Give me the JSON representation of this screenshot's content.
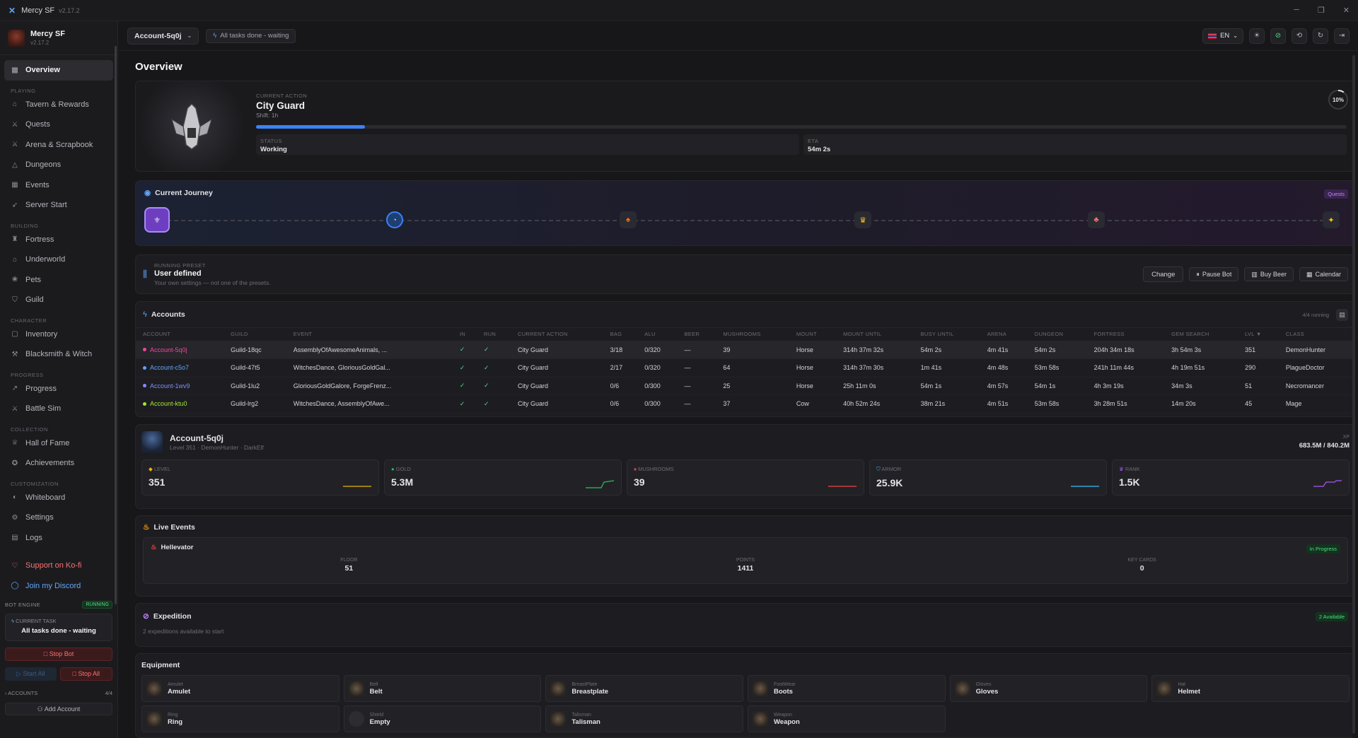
{
  "titlebar": {
    "app": "Mercy SF",
    "version": "v2.17.2"
  },
  "sidebar": {
    "name": "Mercy SF",
    "version": "v2.17.2",
    "items": [
      {
        "type": "item",
        "label": "Overview",
        "icon": "grid-icon",
        "active": true
      },
      {
        "type": "section",
        "label": "PLAYING"
      },
      {
        "type": "item",
        "label": "Tavern & Rewards",
        "icon": "tavern-icon"
      },
      {
        "type": "item",
        "label": "Quests",
        "icon": "swords-icon"
      },
      {
        "type": "item",
        "label": "Arena & Scrapbook",
        "icon": "swords-icon"
      },
      {
        "type": "item",
        "label": "Dungeons",
        "icon": "mountain-icon"
      },
      {
        "type": "item",
        "label": "Events",
        "icon": "calendar-icon"
      },
      {
        "type": "item",
        "label": "Server Start",
        "icon": "rocket-icon"
      },
      {
        "type": "section",
        "label": "BUILDING"
      },
      {
        "type": "item",
        "label": "Fortress",
        "icon": "castle-icon"
      },
      {
        "type": "item",
        "label": "Underworld",
        "icon": "home-icon"
      },
      {
        "type": "item",
        "label": "Pets",
        "icon": "paw-icon"
      },
      {
        "type": "item",
        "label": "Guild",
        "icon": "shield-icon"
      },
      {
        "type": "section",
        "label": "CHARACTER"
      },
      {
        "type": "item",
        "label": "Inventory",
        "icon": "backpack-icon"
      },
      {
        "type": "item",
        "label": "Blacksmith & Witch",
        "icon": "hammer-icon"
      },
      {
        "type": "section",
        "label": "PROGRESS"
      },
      {
        "type": "item",
        "label": "Progress",
        "icon": "trend-icon"
      },
      {
        "type": "item",
        "label": "Battle Sim",
        "icon": "swords-icon"
      },
      {
        "type": "section",
        "label": "COLLECTION"
      },
      {
        "type": "item",
        "label": "Hall of Fame",
        "icon": "trophy-icon"
      },
      {
        "type": "item",
        "label": "Achievements",
        "icon": "medal-icon"
      },
      {
        "type": "section",
        "label": "CUSTOMIZATION"
      },
      {
        "type": "item",
        "label": "Whiteboard",
        "icon": "palette-icon"
      },
      {
        "type": "item",
        "label": "Settings",
        "icon": "gear-icon"
      },
      {
        "type": "item",
        "label": "Logs",
        "icon": "file-icon"
      }
    ],
    "kofi": "Support on Ko-fi",
    "discord": "Join my Discord",
    "engine": {
      "label": "BOT ENGINE",
      "status": "RUNNING",
      "task_label": "CURRENT TASK",
      "task": "All tasks done - waiting",
      "stop_bot": "Stop Bot",
      "start_all": "Start All",
      "stop_all": "Stop All",
      "accounts_label": "ACCOUNTS",
      "accounts_count": "4/4",
      "add_account": "Add Account"
    }
  },
  "topbar": {
    "account": "Account-5q0j",
    "task": "All tasks done - waiting",
    "lang": "EN"
  },
  "page_title": "Overview",
  "action": {
    "label": "CURRENT ACTION",
    "title": "City Guard",
    "sub": "Shift: 1h",
    "progress": 0.1,
    "percent": "10%",
    "status_label": "STATUS",
    "status": "Working",
    "eta_label": "ETA",
    "eta": "54m 2s"
  },
  "journey": {
    "title": "Current Journey",
    "badge": "Quests"
  },
  "preset": {
    "label": "RUNNING PRESET",
    "title": "User defined",
    "desc": "Your own settings — not one of the presets.",
    "change": "Change",
    "pause": "Pause Bot",
    "beer": "Buy Beer",
    "calendar": "Calendar"
  },
  "accounts": {
    "title": "Accounts",
    "running": "4/4 running",
    "columns": [
      "ACCOUNT",
      "GUILD",
      "EVENT",
      "IN",
      "RUN",
      "CURRENT ACTION",
      "BAG",
      "ALU",
      "BEER",
      "MUSHROOMS",
      "MOUNT",
      "MOUNT UNTIL",
      "BUSY UNTIL",
      "ARENA",
      "DUNGEON",
      "FORTRESS",
      "GEM SEARCH",
      "LVL ▼",
      "CLASS"
    ],
    "rows": [
      {
        "color": "#ec4899",
        "cells": [
          "Account-5q0j",
          "Guild-18qc",
          "AssemblyOfAwesomeAnimals, ...",
          "✓",
          "✓",
          "City Guard",
          "3/18",
          "0/320",
          "—",
          "39",
          "Horse",
          "314h 37m 32s",
          "54m 2s",
          "4m 41s",
          "54m 2s",
          "204h 34m 18s",
          "3h 54m 3s",
          "351",
          "DemonHunter"
        ]
      },
      {
        "color": "#60a5fa",
        "cells": [
          "Account-c5o7",
          "Guild-47t5",
          "WitchesDance, GloriousGoldGal...",
          "✓",
          "✓",
          "City Guard",
          "2/17",
          "0/320",
          "—",
          "64",
          "Horse",
          "314h 37m 30s",
          "1m 41s",
          "4m 48s",
          "53m 58s",
          "241h 11m 44s",
          "4h 19m 51s",
          "290",
          "PlagueDoctor"
        ]
      },
      {
        "color": "#818cf8",
        "cells": [
          "Account-1wv9",
          "Guild-1lu2",
          "GloriousGoldGalore, ForgeFrenz...",
          "✓",
          "✓",
          "City Guard",
          "0/6",
          "0/300",
          "—",
          "25",
          "Horse",
          "25h 11m 0s",
          "54m 1s",
          "4m 57s",
          "54m 1s",
          "4h 3m 19s",
          "34m 3s",
          "51",
          "Necromancer"
        ]
      },
      {
        "color": "#a3e635",
        "cells": [
          "Account-ktu0",
          "Guild-lrg2",
          "WitchesDance, AssemblyOfAwe...",
          "✓",
          "✓",
          "City Guard",
          "0/6",
          "0/300",
          "—",
          "37",
          "Cow",
          "40h 52m 24s",
          "38m 21s",
          "4m 51s",
          "53m 58s",
          "3h 28m 51s",
          "14m 20s",
          "45",
          "Mage"
        ]
      }
    ]
  },
  "profile": {
    "name": "Account-5q0j",
    "sub": "Level 351 · DemonHunter · DarkElf",
    "xp_label": "XP",
    "xp": "683.5M / 840.2M",
    "stats": [
      {
        "label": "LEVEL",
        "value": "351",
        "color": "#eab308",
        "icon": "diamond-icon"
      },
      {
        "label": "GOLD",
        "value": "5.3M",
        "color": "#22c55e",
        "icon": "coin-icon"
      },
      {
        "label": "MUSHROOMS",
        "value": "39",
        "color": "#ef4444",
        "icon": "mushroom-icon"
      },
      {
        "label": "ARMOR",
        "value": "25.9K",
        "color": "#38bdf8",
        "icon": "armor-icon"
      },
      {
        "label": "RANK",
        "value": "1.5K",
        "color": "#a855f7",
        "icon": "rank-icon"
      }
    ]
  },
  "events": {
    "title": "Live Events",
    "name": "Hellevator",
    "badge": "In Progress",
    "stats": [
      {
        "label": "FLOOR",
        "value": "51"
      },
      {
        "label": "POINTS",
        "value": "1411"
      },
      {
        "label": "KEY CARDS",
        "value": "0"
      }
    ]
  },
  "expedition": {
    "title": "Expedition",
    "badge": "2 Available",
    "sub": "2 expeditions available to start"
  },
  "equipment": {
    "title": "Equipment",
    "items": [
      {
        "slot": "Amulet",
        "name": "Amulet"
      },
      {
        "slot": "Belt",
        "name": "Belt"
      },
      {
        "slot": "BreastPlate",
        "name": "Breastplate"
      },
      {
        "slot": "FootWear",
        "name": "Boots"
      },
      {
        "slot": "Gloves",
        "name": "Gloves"
      },
      {
        "slot": "Hat",
        "name": "Helmet"
      },
      {
        "slot": "Ring",
        "name": "Ring"
      },
      {
        "slot": "Shield",
        "name": "Empty",
        "empty": true
      },
      {
        "slot": "Talisman",
        "name": "Talisman"
      },
      {
        "slot": "Weapon",
        "name": "Weapon"
      }
    ]
  }
}
